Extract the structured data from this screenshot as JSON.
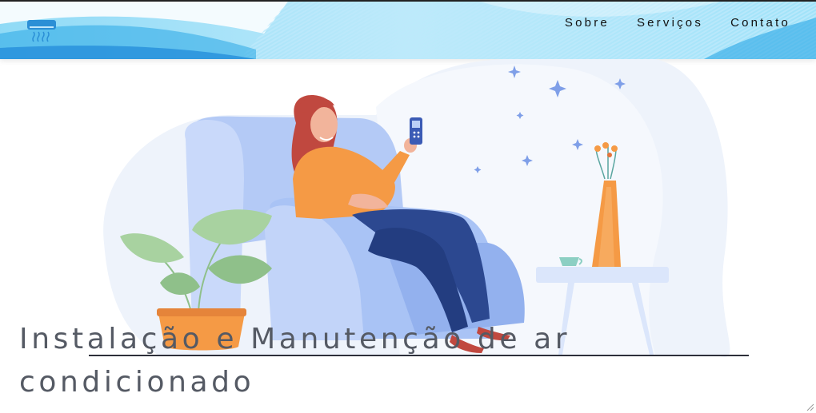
{
  "header": {
    "logo_icon": "air-conditioner-icon",
    "nav": [
      {
        "label": "Sobre"
      },
      {
        "label": "Serviços"
      },
      {
        "label": "Contato"
      }
    ]
  },
  "hero": {
    "title": "Instalação e Manutenção de ar condicionado",
    "illustration": "woman-on-armchair-with-remote"
  },
  "colors": {
    "accent_blue": "#4fc3f7",
    "title_color": "#555a64",
    "armchair": "#a9c3f5",
    "sweater": "#f59a45"
  }
}
